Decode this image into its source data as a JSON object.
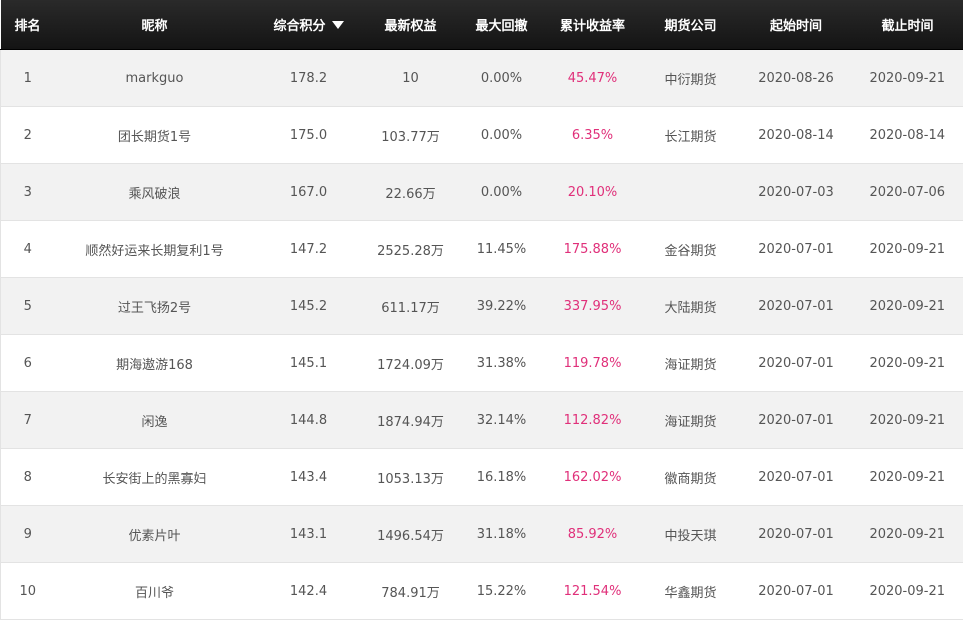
{
  "headers": {
    "rank": "排名",
    "nickname": "昵称",
    "score": "综合积分",
    "equity": "最新权益",
    "drawdown": "最大回撤",
    "return": "累计收益率",
    "company": "期货公司",
    "start": "起始时间",
    "end": "截止时间"
  },
  "sort": {
    "column": "score",
    "direction": "desc",
    "icon": "sort-down-icon"
  },
  "colors": {
    "header_bg": "#1c1c1c",
    "return_text": "#e0307a",
    "row_alt": "#f2f2f2"
  },
  "rows": [
    {
      "rank": "1",
      "nickname": "markguo",
      "score": "178.2",
      "equity": "10",
      "drawdown": "0.00%",
      "return": "45.47%",
      "company": "中衍期货",
      "start": "2020-08-26",
      "end": "2020-09-21"
    },
    {
      "rank": "2",
      "nickname": "团长期货1号",
      "score": "175.0",
      "equity": "103.77万",
      "drawdown": "0.00%",
      "return": "6.35%",
      "company": "长江期货",
      "start": "2020-08-14",
      "end": "2020-08-14"
    },
    {
      "rank": "3",
      "nickname": "乘风破浪",
      "score": "167.0",
      "equity": "22.66万",
      "drawdown": "0.00%",
      "return": "20.10%",
      "company": "",
      "start": "2020-07-03",
      "end": "2020-07-06"
    },
    {
      "rank": "4",
      "nickname": "顺然好运来长期复利1号",
      "score": "147.2",
      "equity": "2525.28万",
      "drawdown": "11.45%",
      "return": "175.88%",
      "company": "金谷期货",
      "start": "2020-07-01",
      "end": "2020-09-21"
    },
    {
      "rank": "5",
      "nickname": "过王飞扬2号",
      "score": "145.2",
      "equity": "611.17万",
      "drawdown": "39.22%",
      "return": "337.95%",
      "company": "大陆期货",
      "start": "2020-07-01",
      "end": "2020-09-21"
    },
    {
      "rank": "6",
      "nickname": "期海遨游168",
      "score": "145.1",
      "equity": "1724.09万",
      "drawdown": "31.38%",
      "return": "119.78%",
      "company": "海证期货",
      "start": "2020-07-01",
      "end": "2020-09-21"
    },
    {
      "rank": "7",
      "nickname": "闲逸",
      "score": "144.8",
      "equity": "1874.94万",
      "drawdown": "32.14%",
      "return": "112.82%",
      "company": "海证期货",
      "start": "2020-07-01",
      "end": "2020-09-21"
    },
    {
      "rank": "8",
      "nickname": "长安街上的黑寡妇",
      "score": "143.4",
      "equity": "1053.13万",
      "drawdown": "16.18%",
      "return": "162.02%",
      "company": "徽商期货",
      "start": "2020-07-01",
      "end": "2020-09-21"
    },
    {
      "rank": "9",
      "nickname": "优素片叶",
      "score": "143.1",
      "equity": "1496.54万",
      "drawdown": "31.18%",
      "return": "85.92%",
      "company": "中投天琪",
      "start": "2020-07-01",
      "end": "2020-09-21"
    },
    {
      "rank": "10",
      "nickname": "百川爷",
      "score": "142.4",
      "equity": "784.91万",
      "drawdown": "15.22%",
      "return": "121.54%",
      "company": "华鑫期货",
      "start": "2020-07-01",
      "end": "2020-09-21"
    }
  ]
}
